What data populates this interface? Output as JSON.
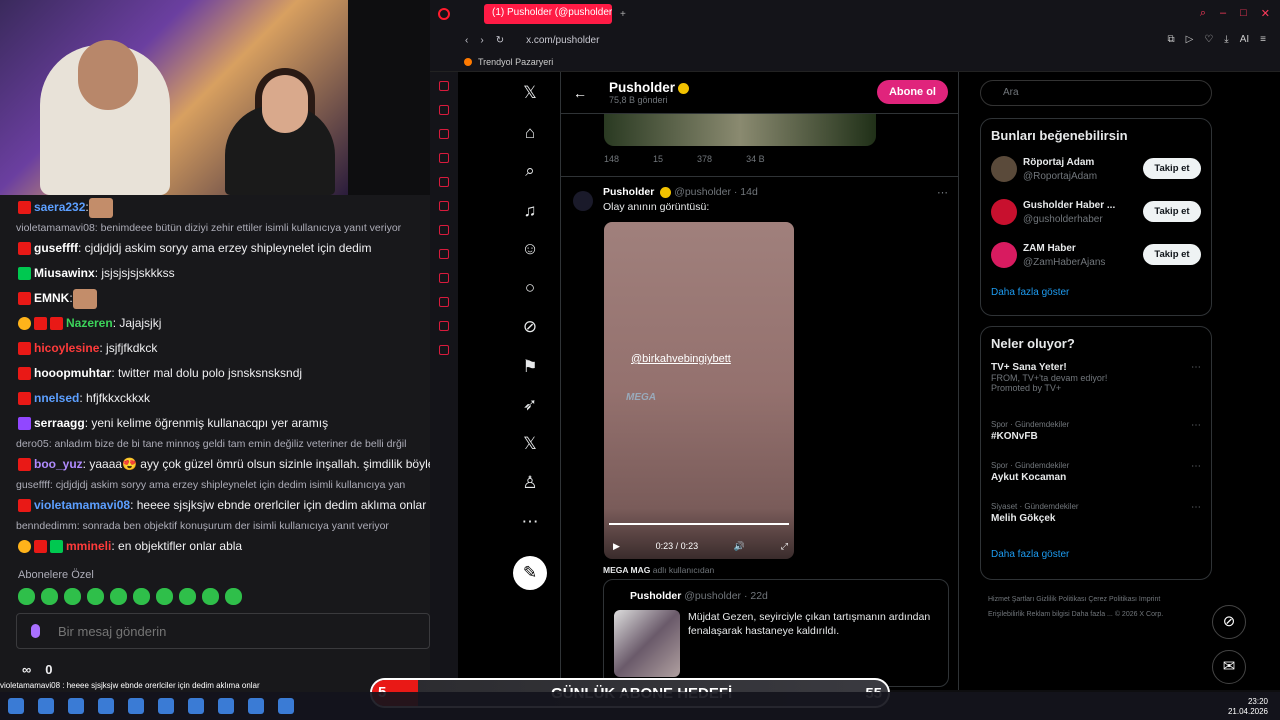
{
  "chat": {
    "messages": [
      {
        "type": "msg",
        "user": "saera232",
        "ucls": "u-blue",
        "badges": [
          "r"
        ],
        "text": ":",
        "emote": true
      },
      {
        "type": "reply",
        "text": "violetamamavi08: benimdeee bütün diziyi zehir ettiler isimli kullanıcıya yanıt veriyor"
      },
      {
        "type": "msg",
        "user": "guseffff",
        "ucls": "u-white",
        "badges": [
          "r"
        ],
        "text": ": cjdjdjdj askim soryy ama erzey shipleynelet için dedim"
      },
      {
        "type": "msg",
        "user": "Miusawinx",
        "ucls": "u-white",
        "badges": [
          "g"
        ],
        "text": ": jsjsjsjsjskkkss"
      },
      {
        "type": "msg",
        "user": "EMNK",
        "ucls": "u-white",
        "badges": [
          "r"
        ],
        "text": ":",
        "emote": true
      },
      {
        "type": "msg",
        "user": "Nazeren",
        "ucls": "u-green",
        "badges": [
          "y",
          "r",
          "r"
        ],
        "text": ": Jajajsjkj"
      },
      {
        "type": "msg",
        "user": "hicoylesine",
        "ucls": "u-red",
        "badges": [
          "r"
        ],
        "text": ": jsjfjfkdkck"
      },
      {
        "type": "msg",
        "user": "hooopmuhtar",
        "ucls": "u-white",
        "badges": [
          "r"
        ],
        "text": ": twitter mal dolu polo jsnsksnsksndj"
      },
      {
        "type": "msg",
        "user": "nnelsed",
        "ucls": "u-blue",
        "badges": [
          "r"
        ],
        "text": ": hfjfkkxckkxk"
      },
      {
        "type": "msg",
        "user": "serraagg",
        "ucls": "u-white",
        "badges": [
          "p"
        ],
        "text": ": yeni kelime öğrenmiş kullanacqpı yer aramış"
      },
      {
        "type": "reply",
        "text": "dero05: anladım bize de bi tane minnoş geldi tam emin değiliz veteriner de belli drğil"
      },
      {
        "type": "msg",
        "user": "boo_yuz",
        "ucls": "u-purple",
        "badges": [
          "r"
        ],
        "text": ": yaaaa😍 ayy çok güzel ömrü olsun sizinle inşallah. şimdilik böyle bi"
      },
      {
        "type": "reply",
        "text": "guseffff: cjdjdjdj askim soryy ama erzey shipleynelet için dedim isimli kullanıcıya yan"
      },
      {
        "type": "msg",
        "user": "violetamamavi08",
        "ucls": "u-blue",
        "badges": [
          "r"
        ],
        "text": ": heeee sjsjksjw ebnde orerlciler için dedim aklıma onlar gel"
      },
      {
        "type": "reply",
        "text": "benndedimm: sonrada ben objektif konuşurum der isimli kullanıcıya yanıt veriyor"
      },
      {
        "type": "msg",
        "user": "mmineli",
        "ucls": "u-red",
        "badges": [
          "y",
          "r",
          "g"
        ],
        "text": ": en objektifler onlar abla"
      }
    ],
    "subscribers_label": "Abonelere Özel",
    "input_placeholder": "Bir mesaj gönderin",
    "stat_viewers": "∞",
    "stat_count": "0",
    "ticker": "violetamamavi08 : heeee sjsjksjw ebnde orerlciler için dedim aklıma onlar"
  },
  "browser": {
    "tab_title": "(1) Pusholder (@pusholder",
    "url": "x.com/pusholder",
    "bookmark": "Trendyol Pazaryeri",
    "ai_label": "AI"
  },
  "profile": {
    "name": "Pusholder",
    "posts": "75,8 B gönderi",
    "subscribe": "Abone ol"
  },
  "prev_actions": {
    "replies": "148",
    "reposts": "15",
    "likes": "378",
    "views": "34 B"
  },
  "post": {
    "name": "Pusholder",
    "handle": "@pusholder · 14d",
    "text": "Olay anının görüntüsü:",
    "watermark": "@birkahvebingiybett",
    "logo": "MEGA",
    "time": "0:23 / 0:23",
    "quote_label": "MEGA MAG",
    "quote_label_suffix": "adlı kullanıcıdan",
    "quote_name": "Pusholder",
    "quote_handle": "@pusholder · 22d",
    "quote_text": "Müjdat Gezen, seyirciyle çıkan tartışmanın ardından fenalaşarak hastaneye kaldırıldı."
  },
  "right": {
    "search_placeholder": "Ara",
    "suggest_title": "Bunları beğenebilirsin",
    "suggestions": [
      {
        "name": "Röportaj Adam",
        "handle": "@RoportajAdam",
        "btn": "Takip et"
      },
      {
        "name": "Gusholder Haber ...",
        "handle": "@gusholderhaber",
        "btn": "Takip et"
      },
      {
        "name": "ZAM Haber",
        "handle": "@ZamHaberAjans",
        "btn": "Takip et"
      }
    ],
    "show_more": "Daha fazla göster",
    "trends_title": "Neler oluyor?",
    "trends": [
      {
        "cat": "",
        "title": "TV+ Sana Yeter!",
        "desc": "FROM, TV+'ta devam ediyor!",
        "extra": "Promoted by TV+"
      },
      {
        "cat": "Spor · Gündemdekiler",
        "title": "#KONvFB",
        "desc": "",
        "extra": ""
      },
      {
        "cat": "Spor · Gündemdekiler",
        "title": "Aykut Kocaman",
        "desc": "",
        "extra": ""
      },
      {
        "cat": "Siyaset · Gündemdekiler",
        "title": "Melih Gökçek",
        "desc": "",
        "extra": ""
      }
    ],
    "show_more2": "Daha fazla göster",
    "footer": "Hizmet Şartları   Gizlilik Politikası   Çerez Politikası   Imprint   Erişilebilirlik   Reklam bilgisi   Daha fazla ...   © 2026 X Corp."
  },
  "goal": {
    "left": "5",
    "label": "GÜNLÜK ABONE HEDEFİ",
    "right": "55"
  },
  "clock": {
    "time": "23:20",
    "date": "21.04.2026"
  }
}
